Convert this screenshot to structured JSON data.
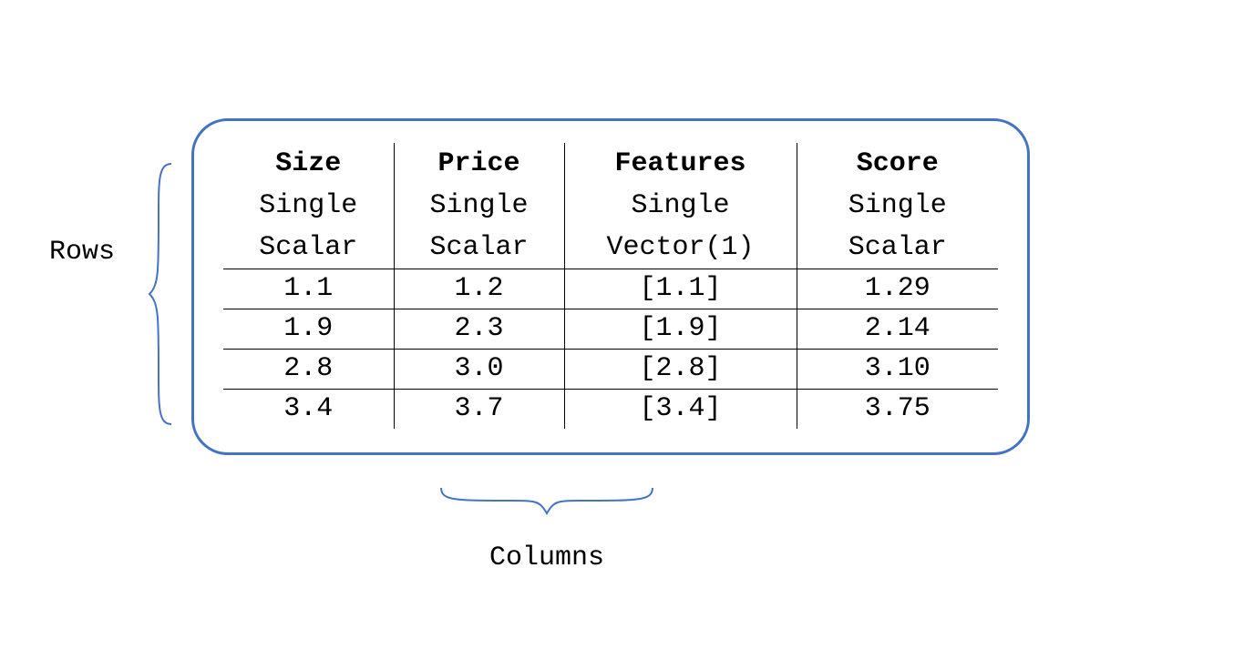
{
  "labels": {
    "rows": "Rows",
    "columns": "Columns"
  },
  "columns": [
    {
      "name": "Size",
      "line2": "Single",
      "line3": "Scalar"
    },
    {
      "name": "Price",
      "line2": "Single",
      "line3": "Scalar"
    },
    {
      "name": "Features",
      "line2": "Single",
      "line3": "Vector(1)"
    },
    {
      "name": "Score",
      "line2": "Single",
      "line3": "Scalar"
    }
  ],
  "rows": [
    {
      "size": "1.1",
      "price": "1.2",
      "features": "[1.1]",
      "score": "1.29"
    },
    {
      "size": "1.9",
      "price": "2.3",
      "features": "[1.9]",
      "score": "2.14"
    },
    {
      "size": "2.8",
      "price": "3.0",
      "features": "[2.8]",
      "score": "3.10"
    },
    {
      "size": "3.4",
      "price": "3.7",
      "features": "[3.4]",
      "score": "3.75"
    }
  ]
}
